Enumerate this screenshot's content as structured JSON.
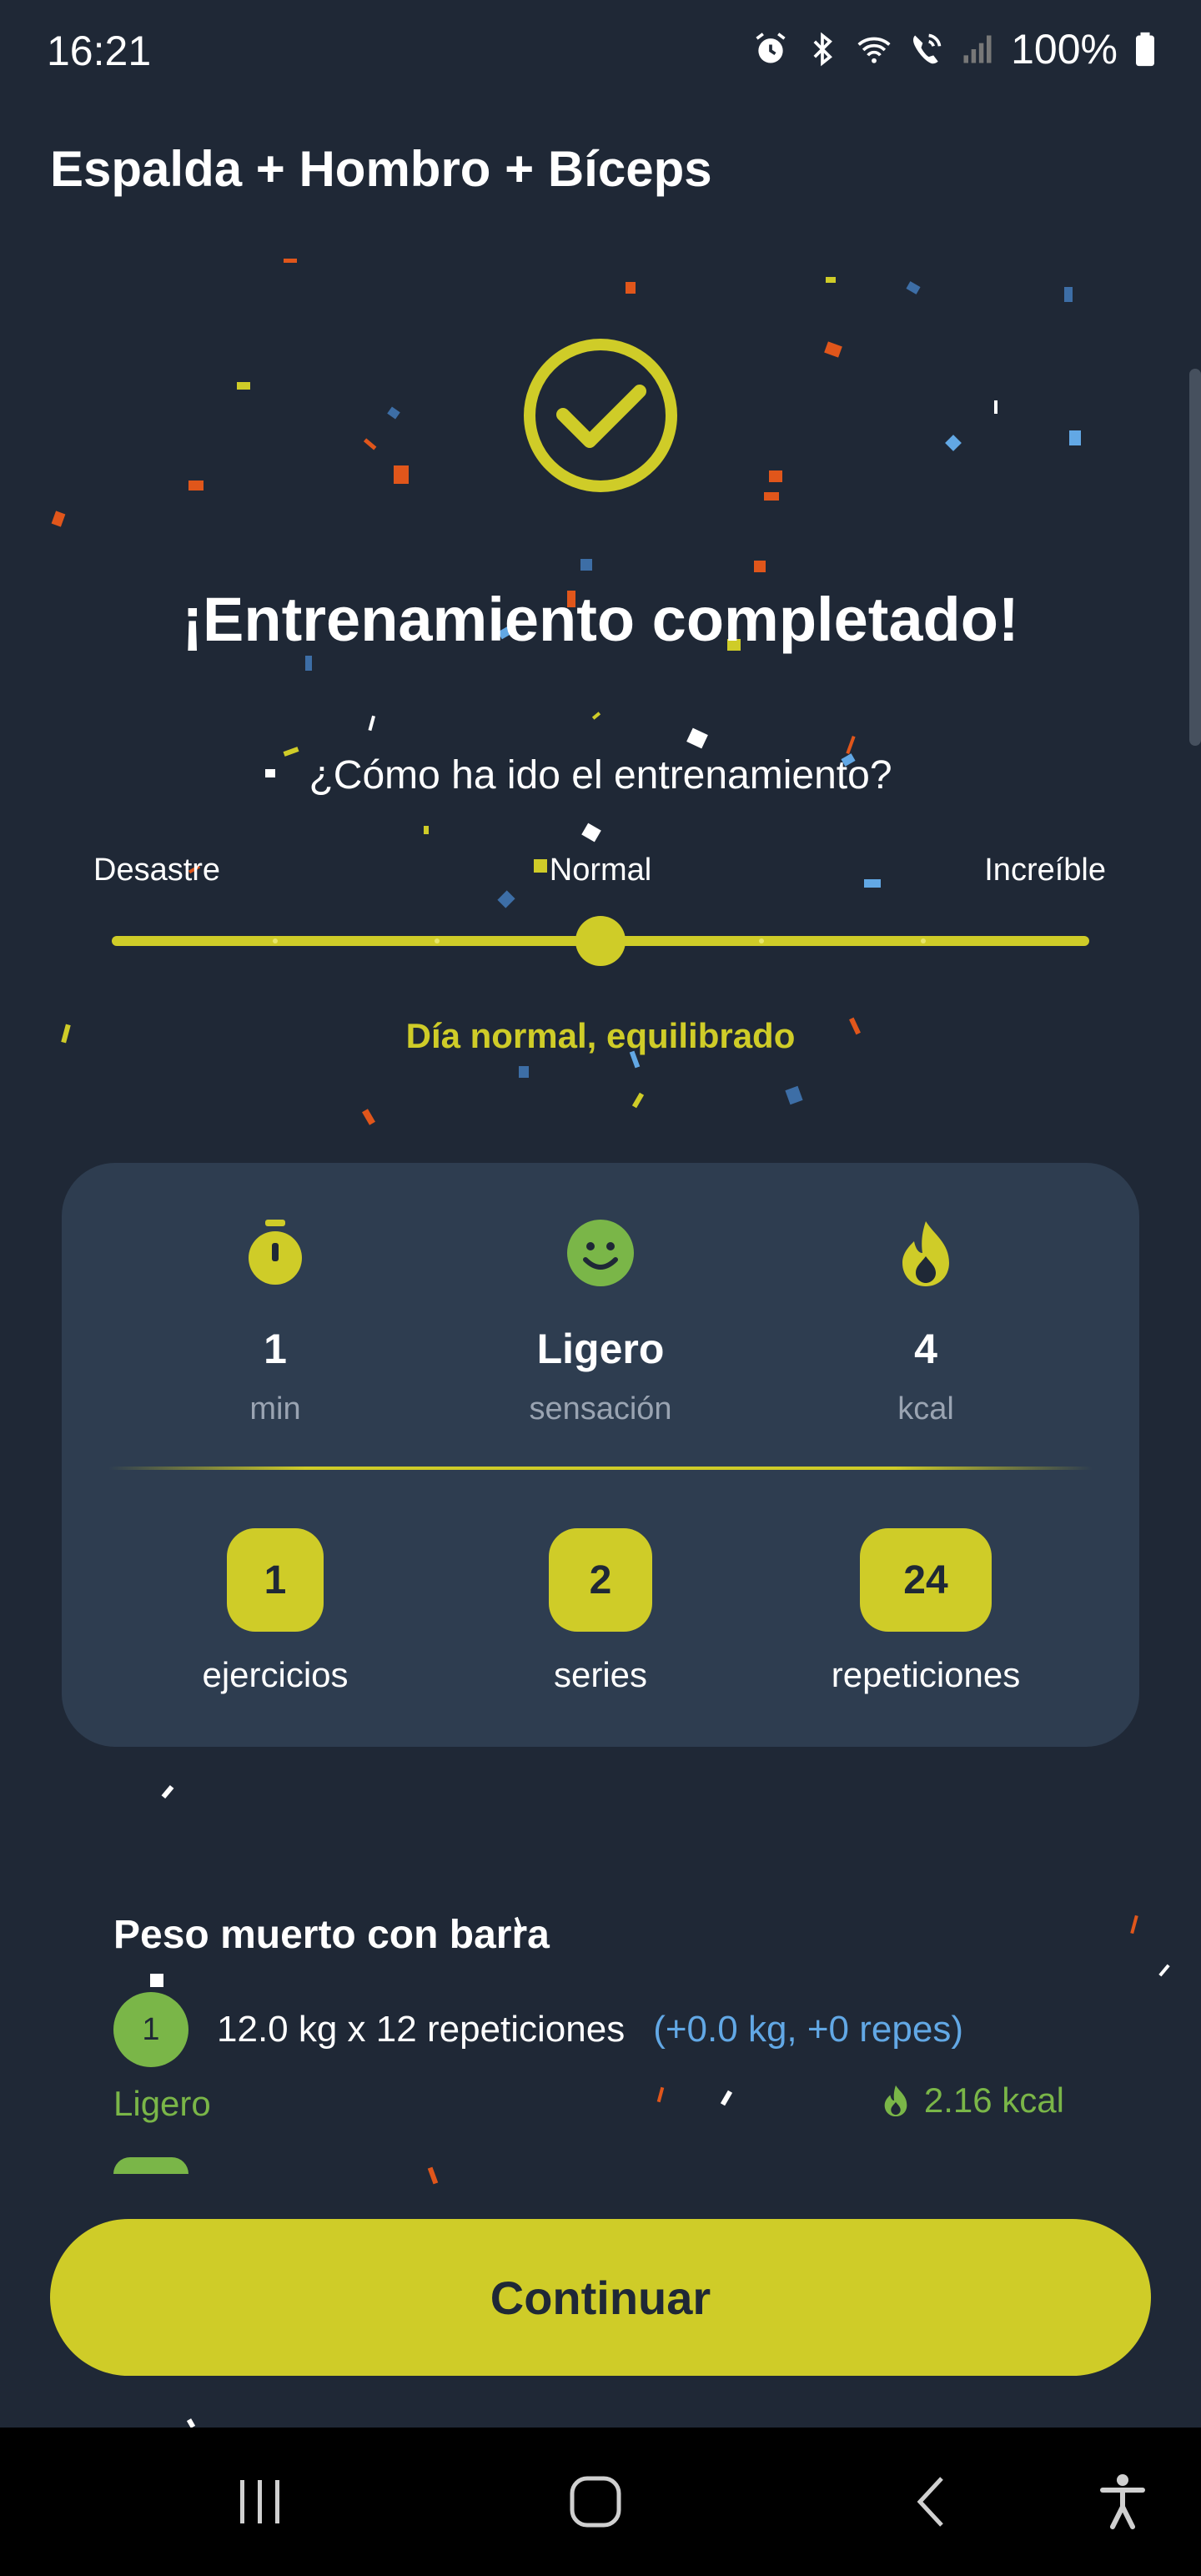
{
  "status_bar": {
    "time": "16:21",
    "battery": "100%",
    "icons": [
      "alarm-icon",
      "bluetooth-icon",
      "wifi-icon",
      "wifi-calling-icon",
      "signal-icon",
      "battery-icon"
    ]
  },
  "workout": {
    "title": "Espalda + Hombro + Bíceps"
  },
  "completion": {
    "heading": "¡Entrenamiento completado!",
    "question": "¿Cómo ha ido el entrenamiento?",
    "scale": {
      "min_label": "Desastre",
      "mid_label": "Normal",
      "max_label": "Increíble",
      "value_fraction": 0.5
    },
    "mood_caption": "Día normal, equilibrado"
  },
  "stats": {
    "duration": {
      "value": "1",
      "label": "min",
      "icon": "stopwatch-icon"
    },
    "feeling": {
      "value": "Ligero",
      "label": "sensación",
      "icon": "smiley-icon"
    },
    "calories": {
      "value": "4",
      "label": "kcal",
      "icon": "flame-icon"
    },
    "exercises": {
      "value": "1",
      "label": "ejercicios"
    },
    "sets": {
      "value": "2",
      "label": "series"
    },
    "reps": {
      "value": "24",
      "label": "repeticiones"
    }
  },
  "exercise_summary": {
    "name": "Peso muerto con barra",
    "set_number": "1",
    "set_detail": "12.0 kg x 12 repeticiones",
    "set_delta": "(+0.0 kg, +0 repes)",
    "set_feel": "Ligero",
    "set_kcal": "2.16 kcal"
  },
  "actions": {
    "continue_label": "Continuar"
  },
  "colors": {
    "background": "#1f2836",
    "card": "#2e3d50",
    "accent": "#cfcc28",
    "green": "#7ab648",
    "blue": "#62a8e5"
  }
}
